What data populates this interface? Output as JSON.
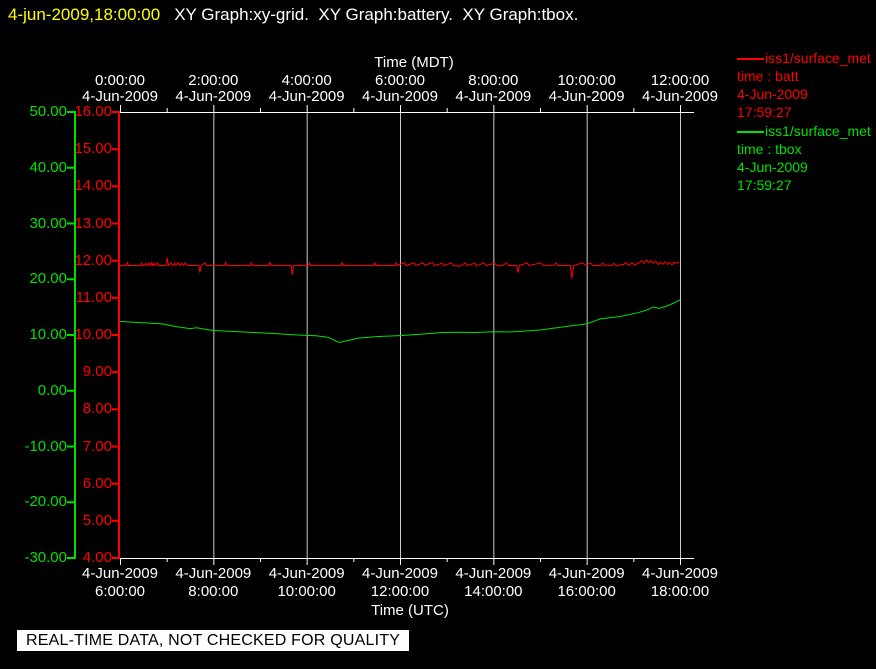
{
  "title_bar": {
    "timestamp": "4-jun-2009,18:00:00",
    "graphs": "XY Graph:xy-grid.  XY Graph:battery.  XY Graph:tbox.",
    "timestamp_color": "#ffff00",
    "text_color": "#ffffff"
  },
  "top_axis": {
    "title": "Time (MDT)",
    "times": [
      "0:00:00",
      "2:00:00",
      "4:00:00",
      "6:00:00",
      "8:00:00",
      "10:00:00",
      "12:00:00"
    ],
    "dates": [
      "4-Jun-2009",
      "4-Jun-2009",
      "4-Jun-2009",
      "4-Jun-2009",
      "4-Jun-2009",
      "4-Jun-2009",
      "4-Jun-2009"
    ]
  },
  "bottom_axis": {
    "title": "Time (UTC)",
    "times": [
      "6:00:00",
      "8:00:00",
      "10:00:00",
      "12:00:00",
      "14:00:00",
      "16:00:00",
      "18:00:00"
    ],
    "dates": [
      "4-Jun-2009",
      "4-Jun-2009",
      "4-Jun-2009",
      "4-Jun-2009",
      "4-Jun-2009",
      "4-Jun-2009",
      "4-Jun-2009"
    ]
  },
  "left_axis_green": {
    "labels": [
      "50.00",
      "40.00",
      "30.00",
      "20.00",
      "10.00",
      "0.00",
      "-10.00",
      "-20.00",
      "-30.00"
    ],
    "color": "#00e000"
  },
  "left_axis_red": {
    "labels": [
      "16.00",
      "15.00",
      "14.00",
      "13.00",
      "12.00",
      "11.00",
      "10.00",
      "9.00",
      "8.00",
      "7.00",
      "6.00",
      "5.00",
      "4.00"
    ],
    "color": "#ff0000"
  },
  "legend": {
    "entries": [
      {
        "source": "iss1/surface_met",
        "variable": "time : batt",
        "date": "4-Jun-2009",
        "time": "17:59:27",
        "color": "#ff0000"
      },
      {
        "source": "iss1/surface_met",
        "variable": "time : tbox",
        "date": "4-Jun-2009",
        "time": "17:59:27",
        "color": "#00e000"
      }
    ]
  },
  "notice": {
    "text": "REAL-TIME DATA, NOT CHECKED FOR QUALITY",
    "bg": "#ffffff",
    "fg": "#000000"
  },
  "colors": {
    "grid": "#c8c8c8",
    "axis": "#ffffff",
    "background": "#000000"
  },
  "chart_data": {
    "type": "line",
    "title": "",
    "x_axis_top_label": "Time (MDT)",
    "x_axis_bottom_label": "Time (UTC)",
    "x_range_utc_hours": [
      6,
      18
    ],
    "x_major_tick_hours_utc": [
      6,
      8,
      10,
      12,
      14,
      16,
      18
    ],
    "x_minor_tick_hours_utc": [
      7,
      9,
      11,
      13,
      15,
      17
    ],
    "gridlines_at_utc_hours": [
      8,
      10,
      12,
      14,
      16,
      18
    ],
    "y_axis_green": {
      "range": [
        -30,
        50
      ],
      "tick_step": 10,
      "color": "#00e000"
    },
    "y_axis_red": {
      "range": [
        4,
        16
      ],
      "tick_step": 1,
      "color": "#ff0000"
    },
    "grid": true,
    "legend_position": "right",
    "series": [
      {
        "name": "iss1/surface_met time : batt",
        "color": "#ff0000",
        "axis": "red",
        "points": [
          [
            6.0,
            11.87
          ],
          [
            6.14,
            11.87
          ],
          [
            6.16,
            11.95
          ],
          [
            6.18,
            11.87
          ],
          [
            6.44,
            11.87
          ],
          [
            6.46,
            11.94
          ],
          [
            6.48,
            11.87
          ],
          [
            6.54,
            11.87
          ],
          [
            6.56,
            11.93
          ],
          [
            6.6,
            11.87
          ],
          [
            6.62,
            11.94
          ],
          [
            6.66,
            11.87
          ],
          [
            6.68,
            11.95
          ],
          [
            6.7,
            11.87
          ],
          [
            6.73,
            11.93
          ],
          [
            6.76,
            11.87
          ],
          [
            6.8,
            11.94
          ],
          [
            6.83,
            11.87
          ],
          [
            6.99,
            11.87
          ],
          [
            7.01,
            12.08
          ],
          [
            7.04,
            11.87
          ],
          [
            7.1,
            11.94
          ],
          [
            7.13,
            11.87
          ],
          [
            7.17,
            11.93
          ],
          [
            7.2,
            11.87
          ],
          [
            7.24,
            11.94
          ],
          [
            7.28,
            11.87
          ],
          [
            7.32,
            11.93
          ],
          [
            7.36,
            11.87
          ],
          [
            7.4,
            11.94
          ],
          [
            7.44,
            11.87
          ],
          [
            7.69,
            11.87
          ],
          [
            7.71,
            11.68
          ],
          [
            7.74,
            11.87
          ],
          [
            7.82,
            11.94
          ],
          [
            7.85,
            11.87
          ],
          [
            8.24,
            11.87
          ],
          [
            8.26,
            11.95
          ],
          [
            8.29,
            11.87
          ],
          [
            8.79,
            11.87
          ],
          [
            8.81,
            11.94
          ],
          [
            8.84,
            11.87
          ],
          [
            9.19,
            11.87
          ],
          [
            9.21,
            11.95
          ],
          [
            9.24,
            11.87
          ],
          [
            9.67,
            11.87
          ],
          [
            9.69,
            11.62
          ],
          [
            9.72,
            11.87
          ],
          [
            10.04,
            11.87
          ],
          [
            10.06,
            11.94
          ],
          [
            10.09,
            11.87
          ],
          [
            10.74,
            11.87
          ],
          [
            10.76,
            11.95
          ],
          [
            10.79,
            11.87
          ],
          [
            11.44,
            11.87
          ],
          [
            11.46,
            11.94
          ],
          [
            11.49,
            11.87
          ],
          [
            11.89,
            11.87
          ],
          [
            11.91,
            11.94
          ],
          [
            11.94,
            11.87
          ],
          [
            12.1,
            11.95
          ],
          [
            12.13,
            11.87
          ],
          [
            12.3,
            11.94
          ],
          [
            12.34,
            11.87
          ],
          [
            12.5,
            11.94
          ],
          [
            12.53,
            11.87
          ],
          [
            12.7,
            11.95
          ],
          [
            12.73,
            11.87
          ],
          [
            12.9,
            11.93
          ],
          [
            12.94,
            11.87
          ],
          [
            13.1,
            11.94
          ],
          [
            13.14,
            11.87
          ],
          [
            13.28,
            11.85
          ],
          [
            13.4,
            11.94
          ],
          [
            13.43,
            11.87
          ],
          [
            13.6,
            11.93
          ],
          [
            13.64,
            11.86
          ],
          [
            13.8,
            11.94
          ],
          [
            13.84,
            11.87
          ],
          [
            14.03,
            11.93
          ],
          [
            14.08,
            11.86
          ],
          [
            14.2,
            11.87
          ],
          [
            14.28,
            11.94
          ],
          [
            14.33,
            11.87
          ],
          [
            14.5,
            11.87
          ],
          [
            14.53,
            11.68
          ],
          [
            14.56,
            11.87
          ],
          [
            14.72,
            11.94
          ],
          [
            14.77,
            11.87
          ],
          [
            15.02,
            11.94
          ],
          [
            15.07,
            11.87
          ],
          [
            15.3,
            11.88
          ],
          [
            15.34,
            11.94
          ],
          [
            15.38,
            11.87
          ],
          [
            15.65,
            11.87
          ],
          [
            15.68,
            11.52
          ],
          [
            15.72,
            11.87
          ],
          [
            15.92,
            11.94
          ],
          [
            15.97,
            11.88
          ],
          [
            16.08,
            11.94
          ],
          [
            16.13,
            11.87
          ],
          [
            16.3,
            11.87
          ],
          [
            16.34,
            11.94
          ],
          [
            16.38,
            11.88
          ],
          [
            16.54,
            11.87
          ],
          [
            16.58,
            11.93
          ],
          [
            16.63,
            11.87
          ],
          [
            16.8,
            11.9
          ],
          [
            16.84,
            11.95
          ],
          [
            16.89,
            11.88
          ],
          [
            16.98,
            11.94
          ],
          [
            17.03,
            11.88
          ],
          [
            17.13,
            11.95
          ],
          [
            17.18,
            12.0
          ],
          [
            17.23,
            11.93
          ],
          [
            17.28,
            12.02
          ],
          [
            17.33,
            11.95
          ],
          [
            17.38,
            12.0
          ],
          [
            17.43,
            11.93
          ],
          [
            17.48,
            11.98
          ],
          [
            17.53,
            11.9
          ],
          [
            17.58,
            11.96
          ],
          [
            17.63,
            11.9
          ],
          [
            17.68,
            11.97
          ],
          [
            17.73,
            11.9
          ],
          [
            17.78,
            11.95
          ],
          [
            17.83,
            11.89
          ],
          [
            17.88,
            11.96
          ],
          [
            17.93,
            11.93
          ],
          [
            17.98,
            11.95
          ]
        ]
      },
      {
        "name": "iss1/surface_met time : tbox",
        "color": "#00e000",
        "axis": "green",
        "points": [
          [
            6.0,
            12.42
          ],
          [
            6.4,
            12.25
          ],
          [
            6.9,
            12.0
          ],
          [
            7.2,
            11.5
          ],
          [
            7.5,
            11.15
          ],
          [
            7.65,
            11.3
          ],
          [
            7.8,
            11.05
          ],
          [
            8.0,
            10.8
          ],
          [
            8.6,
            10.55
          ],
          [
            9.2,
            10.3
          ],
          [
            9.8,
            10.0
          ],
          [
            10.2,
            9.85
          ],
          [
            10.45,
            9.6
          ],
          [
            10.7,
            8.66
          ],
          [
            10.85,
            8.95
          ],
          [
            11.1,
            9.45
          ],
          [
            11.5,
            9.72
          ],
          [
            12.0,
            9.9
          ],
          [
            12.4,
            10.1
          ],
          [
            12.9,
            10.45
          ],
          [
            13.3,
            10.5
          ],
          [
            13.6,
            10.45
          ],
          [
            14.0,
            10.58
          ],
          [
            14.4,
            10.55
          ],
          [
            15.0,
            10.9
          ],
          [
            15.4,
            11.35
          ],
          [
            15.8,
            11.8
          ],
          [
            16.0,
            12.0
          ],
          [
            16.3,
            12.9
          ],
          [
            16.7,
            13.3
          ],
          [
            17.1,
            14.0
          ],
          [
            17.3,
            14.5
          ],
          [
            17.42,
            15.0
          ],
          [
            17.5,
            14.9
          ],
          [
            17.55,
            14.75
          ],
          [
            17.75,
            15.3
          ],
          [
            17.93,
            16.0
          ],
          [
            18.0,
            16.3
          ]
        ]
      }
    ]
  }
}
